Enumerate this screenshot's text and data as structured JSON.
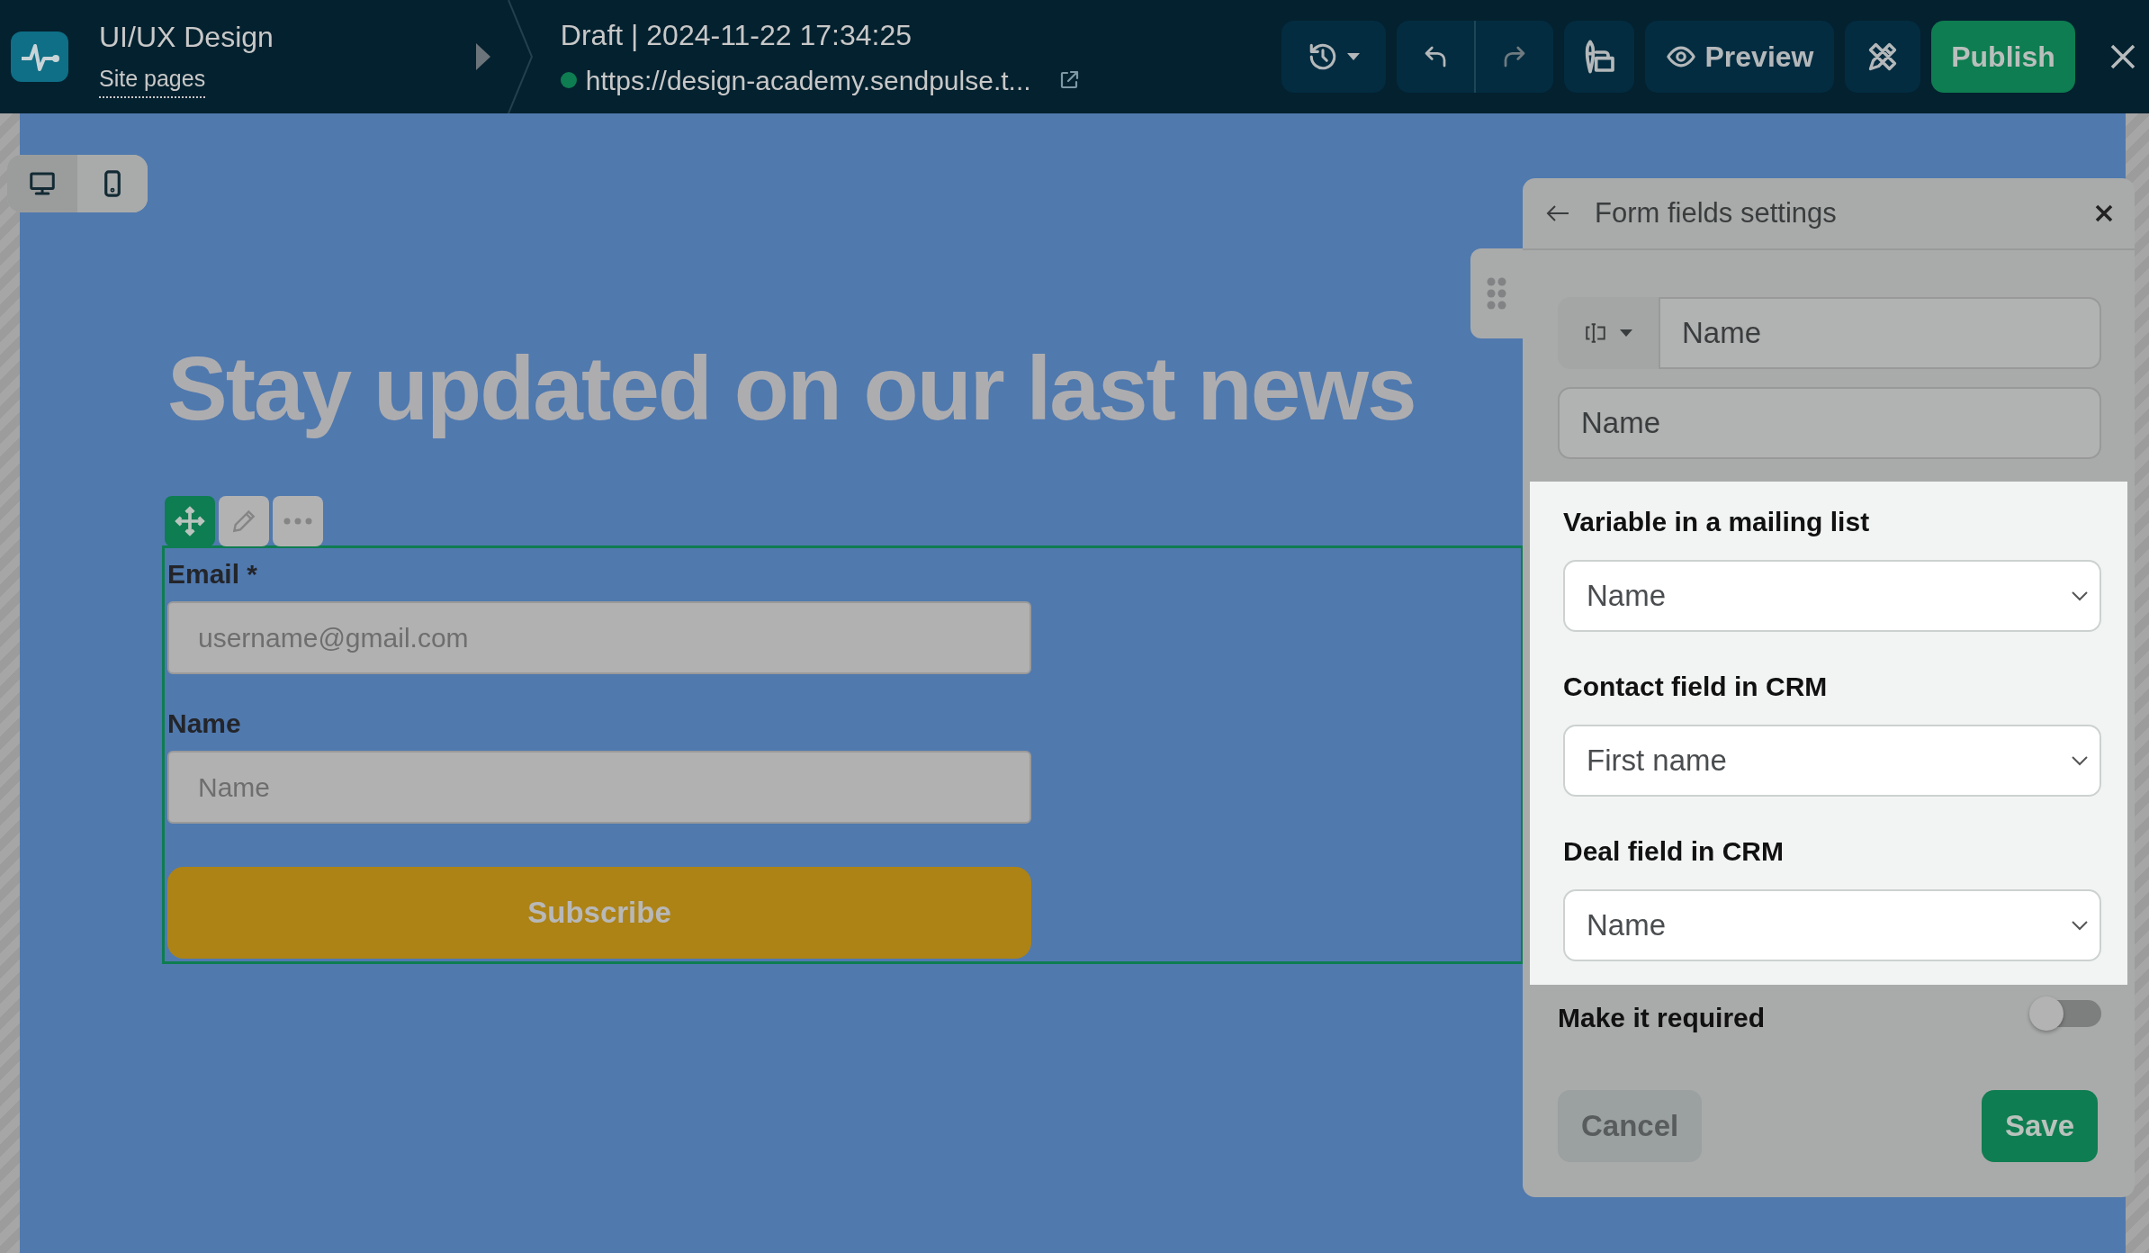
{
  "header": {
    "site_title": "UI/UX Design",
    "site_pages_link": "Site pages",
    "draft_status": "Draft | 2024-11-22 17:34:25",
    "url": "https://design-academy.sendpulse.t...",
    "preview_button": "Preview",
    "publish_button": "Publish"
  },
  "device_toggle": [
    {
      "kind": "desktop",
      "selected": true
    },
    {
      "kind": "mobile",
      "selected": false
    }
  ],
  "canvas": {
    "heading": "Stay updated on our last news",
    "form": {
      "fields": [
        {
          "label": "Email *",
          "placeholder": "username@gmail.com"
        },
        {
          "label": "Name",
          "placeholder": "Name"
        }
      ],
      "submit_button": "Subscribe"
    }
  },
  "panel": {
    "title": "Form fields settings",
    "field_type_value": "Name",
    "label_value": "Name",
    "mappings": [
      {
        "label": "Variable in a mailing list",
        "value": "Name"
      },
      {
        "label": "Contact field in CRM",
        "value": "First name"
      },
      {
        "label": "Deal field in CRM",
        "value": "Name"
      }
    ],
    "required_toggle": {
      "label": "Make it required",
      "on": false
    },
    "cancel_button": "Cancel",
    "save_button": "Save"
  }
}
